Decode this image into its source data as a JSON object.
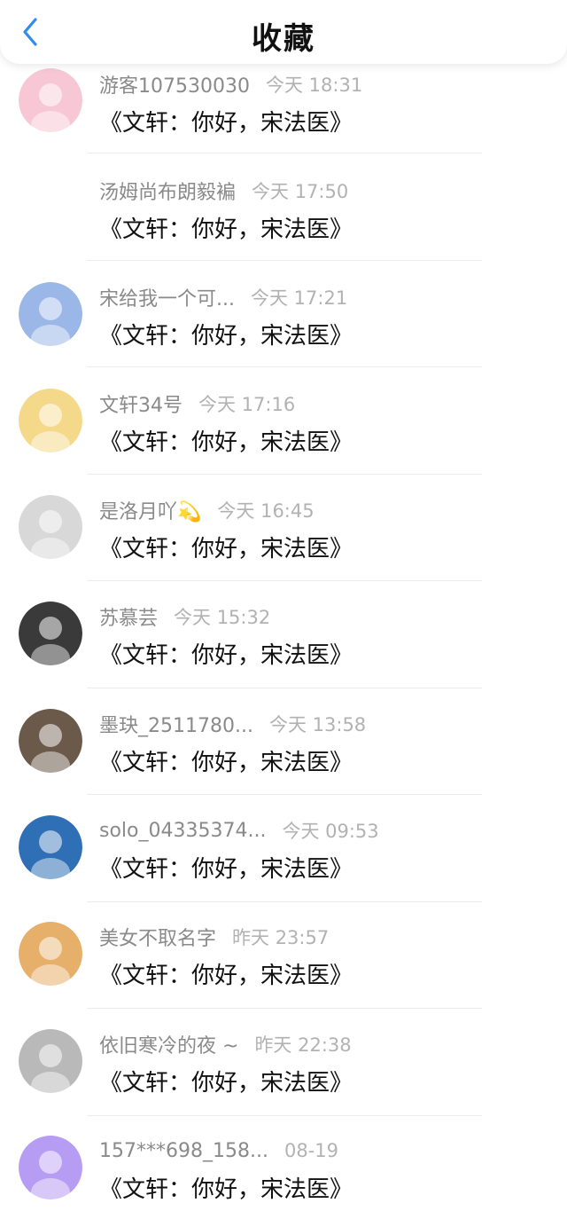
{
  "header": {
    "title": "收藏"
  },
  "items": [
    {
      "name": "游客107530030",
      "time": "今天 18:31",
      "content": "《文轩：你好，宋法医》",
      "avatar_color": "#f7c7d6",
      "show_avatar": true
    },
    {
      "name": "汤姆尚布朗毅褊",
      "time": "今天 17:50",
      "content": "《文轩：你好，宋法医》",
      "avatar_color": "#ffffff",
      "show_avatar": false
    },
    {
      "name": "宋给我一个可...",
      "time": "今天 17:21",
      "content": "《文轩：你好，宋法医》",
      "avatar_color": "#9bb7e8",
      "show_avatar": true
    },
    {
      "name": "文轩34号",
      "time": "今天 17:16",
      "content": "《文轩：你好，宋法医》",
      "avatar_color": "#f5d98a",
      "show_avatar": true
    },
    {
      "name": "是洛月吖💫",
      "time": "今天 16:45",
      "content": "《文轩：你好，宋法医》",
      "avatar_color": "#d8d8d8",
      "show_avatar": true
    },
    {
      "name": "苏慕芸",
      "time": "今天 15:32",
      "content": "《文轩：你好，宋法医》",
      "avatar_color": "#3a3a3a",
      "show_avatar": true
    },
    {
      "name": "墨玦_2511780...",
      "time": "今天 13:58",
      "content": "《文轩：你好，宋法医》",
      "avatar_color": "#6b5a4a",
      "show_avatar": true
    },
    {
      "name": "solo_04335374...",
      "time": "今天 09:53",
      "content": "《文轩：你好，宋法医》",
      "avatar_color": "#2f6fb5",
      "show_avatar": true
    },
    {
      "name": "美女不取名字",
      "time": "昨天 23:57",
      "content": "《文轩：你好，宋法医》",
      "avatar_color": "#e7b06a",
      "show_avatar": true
    },
    {
      "name": "依旧寒冷的夜 ~",
      "time": "昨天 22:38",
      "content": "《文轩：你好，宋法医》",
      "avatar_color": "#b9b9b9",
      "show_avatar": true
    },
    {
      "name": "157***698_158...",
      "time": "08-19",
      "content": "《文轩：你好，宋法医》",
      "avatar_color": "#b79cf3",
      "show_avatar": true
    }
  ]
}
